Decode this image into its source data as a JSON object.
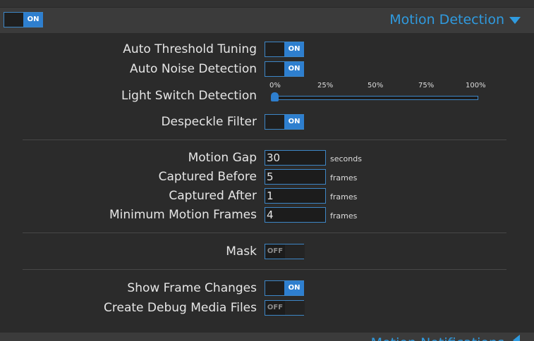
{
  "header": {
    "enable_switch": {
      "state": "on",
      "label": "ON"
    },
    "title": "Motion Detection",
    "chevron_icon": "chevron-down-icon",
    "accent_color": "#2f9be0"
  },
  "settings": {
    "auto_threshold": {
      "label": "Auto Threshold Tuning",
      "switch": "ON"
    },
    "auto_noise": {
      "label": "Auto Noise Detection",
      "switch": "ON"
    },
    "light_switch": {
      "label": "Light Switch Detection",
      "ticks": [
        "0%",
        "25%",
        "50%",
        "75%",
        "100%"
      ],
      "value_fraction": 0
    },
    "despeckle": {
      "label": "Despeckle Filter",
      "switch": "ON"
    },
    "motion_gap": {
      "label": "Motion Gap",
      "value": "30",
      "unit": "seconds"
    },
    "captured_before": {
      "label": "Captured Before",
      "value": "5",
      "unit": "frames"
    },
    "captured_after": {
      "label": "Captured After",
      "value": "1",
      "unit": "frames"
    },
    "min_motion_frames": {
      "label": "Minimum Motion Frames",
      "value": "4",
      "unit": "frames"
    },
    "mask": {
      "label": "Mask",
      "switch": "OFF"
    },
    "show_frame_changes": {
      "label": "Show Frame Changes",
      "switch": "ON"
    },
    "create_debug_media": {
      "label": "Create Debug Media Files",
      "switch": "OFF"
    }
  },
  "next_section": {
    "title": "Motion Notifications",
    "chevron_icon": "chevron-left-icon"
  }
}
